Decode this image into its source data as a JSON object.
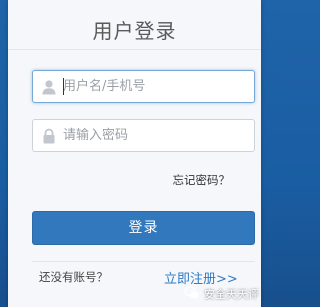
{
  "login_panel": {
    "title": "用户登录",
    "username_placeholder": "用户名/手机号",
    "password_placeholder": "请输入密码",
    "forgot_password": "忘记密码？",
    "login_button": "登录",
    "no_account": "还没有账号？",
    "register_link": "立即注册>>"
  },
  "watermark": {
    "text": "安全天天评"
  },
  "colors": {
    "background": "#1f63a8",
    "panel": "#f5f7fa",
    "primary_button": "#3178bd",
    "link": "#2f7bc4",
    "focus_border": "#79a7d8"
  },
  "icons": {
    "username": "user-icon",
    "password": "lock-icon",
    "watermark": "wechat-icon"
  }
}
